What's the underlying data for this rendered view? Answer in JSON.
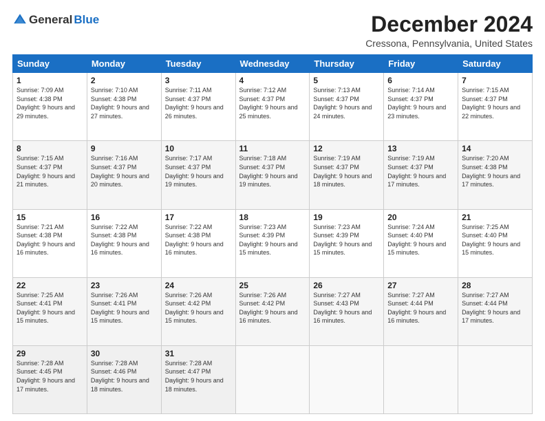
{
  "logo": {
    "general": "General",
    "blue": "Blue"
  },
  "title": "December 2024",
  "location": "Cressona, Pennsylvania, United States",
  "days_of_week": [
    "Sunday",
    "Monday",
    "Tuesday",
    "Wednesday",
    "Thursday",
    "Friday",
    "Saturday"
  ],
  "weeks": [
    [
      {
        "day": "1",
        "sunrise": "7:09 AM",
        "sunset": "4:38 PM",
        "daylight": "9 hours and 29 minutes."
      },
      {
        "day": "2",
        "sunrise": "7:10 AM",
        "sunset": "4:38 PM",
        "daylight": "9 hours and 27 minutes."
      },
      {
        "day": "3",
        "sunrise": "7:11 AM",
        "sunset": "4:37 PM",
        "daylight": "9 hours and 26 minutes."
      },
      {
        "day": "4",
        "sunrise": "7:12 AM",
        "sunset": "4:37 PM",
        "daylight": "9 hours and 25 minutes."
      },
      {
        "day": "5",
        "sunrise": "7:13 AM",
        "sunset": "4:37 PM",
        "daylight": "9 hours and 24 minutes."
      },
      {
        "day": "6",
        "sunrise": "7:14 AM",
        "sunset": "4:37 PM",
        "daylight": "9 hours and 23 minutes."
      },
      {
        "day": "7",
        "sunrise": "7:15 AM",
        "sunset": "4:37 PM",
        "daylight": "9 hours and 22 minutes."
      }
    ],
    [
      {
        "day": "8",
        "sunrise": "7:15 AM",
        "sunset": "4:37 PM",
        "daylight": "9 hours and 21 minutes."
      },
      {
        "day": "9",
        "sunrise": "7:16 AM",
        "sunset": "4:37 PM",
        "daylight": "9 hours and 20 minutes."
      },
      {
        "day": "10",
        "sunrise": "7:17 AM",
        "sunset": "4:37 PM",
        "daylight": "9 hours and 19 minutes."
      },
      {
        "day": "11",
        "sunrise": "7:18 AM",
        "sunset": "4:37 PM",
        "daylight": "9 hours and 19 minutes."
      },
      {
        "day": "12",
        "sunrise": "7:19 AM",
        "sunset": "4:37 PM",
        "daylight": "9 hours and 18 minutes."
      },
      {
        "day": "13",
        "sunrise": "7:19 AM",
        "sunset": "4:37 PM",
        "daylight": "9 hours and 17 minutes."
      },
      {
        "day": "14",
        "sunrise": "7:20 AM",
        "sunset": "4:38 PM",
        "daylight": "9 hours and 17 minutes."
      }
    ],
    [
      {
        "day": "15",
        "sunrise": "7:21 AM",
        "sunset": "4:38 PM",
        "daylight": "9 hours and 16 minutes."
      },
      {
        "day": "16",
        "sunrise": "7:22 AM",
        "sunset": "4:38 PM",
        "daylight": "9 hours and 16 minutes."
      },
      {
        "day": "17",
        "sunrise": "7:22 AM",
        "sunset": "4:38 PM",
        "daylight": "9 hours and 16 minutes."
      },
      {
        "day": "18",
        "sunrise": "7:23 AM",
        "sunset": "4:39 PM",
        "daylight": "9 hours and 15 minutes."
      },
      {
        "day": "19",
        "sunrise": "7:23 AM",
        "sunset": "4:39 PM",
        "daylight": "9 hours and 15 minutes."
      },
      {
        "day": "20",
        "sunrise": "7:24 AM",
        "sunset": "4:40 PM",
        "daylight": "9 hours and 15 minutes."
      },
      {
        "day": "21",
        "sunrise": "7:25 AM",
        "sunset": "4:40 PM",
        "daylight": "9 hours and 15 minutes."
      }
    ],
    [
      {
        "day": "22",
        "sunrise": "7:25 AM",
        "sunset": "4:41 PM",
        "daylight": "9 hours and 15 minutes."
      },
      {
        "day": "23",
        "sunrise": "7:26 AM",
        "sunset": "4:41 PM",
        "daylight": "9 hours and 15 minutes."
      },
      {
        "day": "24",
        "sunrise": "7:26 AM",
        "sunset": "4:42 PM",
        "daylight": "9 hours and 15 minutes."
      },
      {
        "day": "25",
        "sunrise": "7:26 AM",
        "sunset": "4:42 PM",
        "daylight": "9 hours and 16 minutes."
      },
      {
        "day": "26",
        "sunrise": "7:27 AM",
        "sunset": "4:43 PM",
        "daylight": "9 hours and 16 minutes."
      },
      {
        "day": "27",
        "sunrise": "7:27 AM",
        "sunset": "4:44 PM",
        "daylight": "9 hours and 16 minutes."
      },
      {
        "day": "28",
        "sunrise": "7:27 AM",
        "sunset": "4:44 PM",
        "daylight": "9 hours and 17 minutes."
      }
    ],
    [
      {
        "day": "29",
        "sunrise": "7:28 AM",
        "sunset": "4:45 PM",
        "daylight": "9 hours and 17 minutes."
      },
      {
        "day": "30",
        "sunrise": "7:28 AM",
        "sunset": "4:46 PM",
        "daylight": "9 hours and 18 minutes."
      },
      {
        "day": "31",
        "sunrise": "7:28 AM",
        "sunset": "4:47 PM",
        "daylight": "9 hours and 18 minutes."
      },
      null,
      null,
      null,
      null
    ]
  ],
  "labels": {
    "sunrise": "Sunrise:",
    "sunset": "Sunset:",
    "daylight": "Daylight:"
  }
}
